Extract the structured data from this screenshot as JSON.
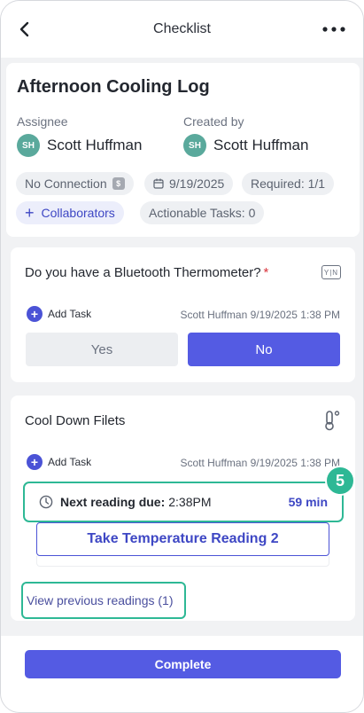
{
  "header": {
    "title": "Checklist",
    "back_icon": "chevron-left-icon",
    "more_icon": "more-horizontal-icon"
  },
  "summary": {
    "title": "Afternoon Cooling Log",
    "assignee_label": "Assignee",
    "assignee_initials": "SH",
    "assignee_name": "Scott Huffman",
    "created_by_label": "Created by",
    "creator_initials": "SH",
    "creator_name": "Scott Huffman",
    "chips": {
      "connection": "No Connection",
      "connection_badge": "$",
      "date": "9/19/2025",
      "required": "Required: 1/1",
      "collaborators": "Collaborators",
      "actionable": "Actionable Tasks: 0"
    }
  },
  "question": {
    "text": "Do you have a Bluetooth Thermometer?",
    "required_mark": "*",
    "icon_text": "Y|N",
    "add_task": "Add Task",
    "stamp": "Scott Huffman 9/19/2025 1:38 PM",
    "yes": "Yes",
    "no": "No",
    "selected": "No"
  },
  "cooldown": {
    "title": "Cool Down Filets",
    "add_task": "Add Task",
    "stamp": "Scott Huffman 9/19/2025 1:38 PM",
    "next_label": "Next reading due:",
    "next_time": "2:38PM",
    "remaining": "59 min",
    "step_number": "5",
    "take_reading": "Take Temperature Reading 2",
    "view_previous": "View previous readings (1)"
  },
  "footer": {
    "complete": "Complete"
  },
  "colors": {
    "accent": "#545be3",
    "highlight": "#2eb895",
    "avatar": "#5aa99c",
    "required": "#d9363e"
  }
}
